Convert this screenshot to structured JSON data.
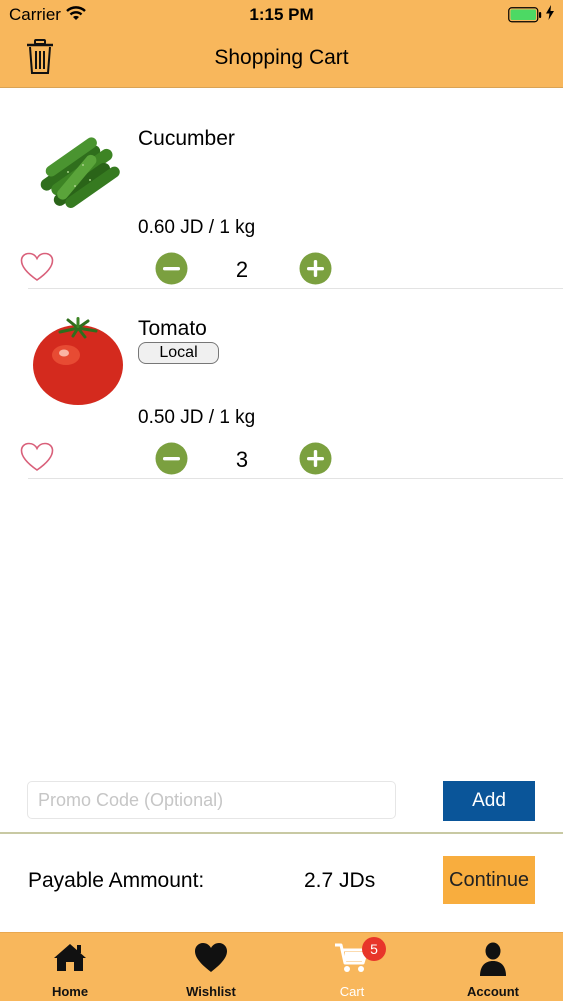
{
  "status_bar": {
    "carrier": "Carrier",
    "time": "1:15 PM",
    "battery_color": "#4cd964"
  },
  "header": {
    "title": "Shopping Cart",
    "icon": "trash-icon",
    "background": "#F8B75C"
  },
  "cart": {
    "items": [
      {
        "name": "Cucumber",
        "badge": "",
        "price": "0.60 JD / 1 kg",
        "quantity": "2",
        "image": "cucumber-image"
      },
      {
        "name": "Tomato",
        "badge": "Local",
        "price": "0.50 JD / 1 kg",
        "quantity": "3",
        "image": "tomato-image"
      }
    ],
    "stepper_color": "#7BA03F",
    "heart_color": "#D9607A"
  },
  "promo": {
    "placeholder": "Promo Code (Optional)",
    "value": "",
    "add_label": "Add",
    "add_color": "#0A5599"
  },
  "summary": {
    "label": "Payable Ammount:",
    "amount": "2.7 JDs",
    "continue_label": "Continue",
    "continue_color": "#F8AD3E"
  },
  "tab_bar": {
    "tabs": [
      {
        "label": "Home",
        "icon": "home-icon"
      },
      {
        "label": "Wishlist",
        "icon": "heart-icon"
      },
      {
        "label": "Cart",
        "icon": "cart-icon",
        "badge": "5",
        "active": true
      },
      {
        "label": "Account",
        "icon": "account-icon"
      }
    ]
  }
}
